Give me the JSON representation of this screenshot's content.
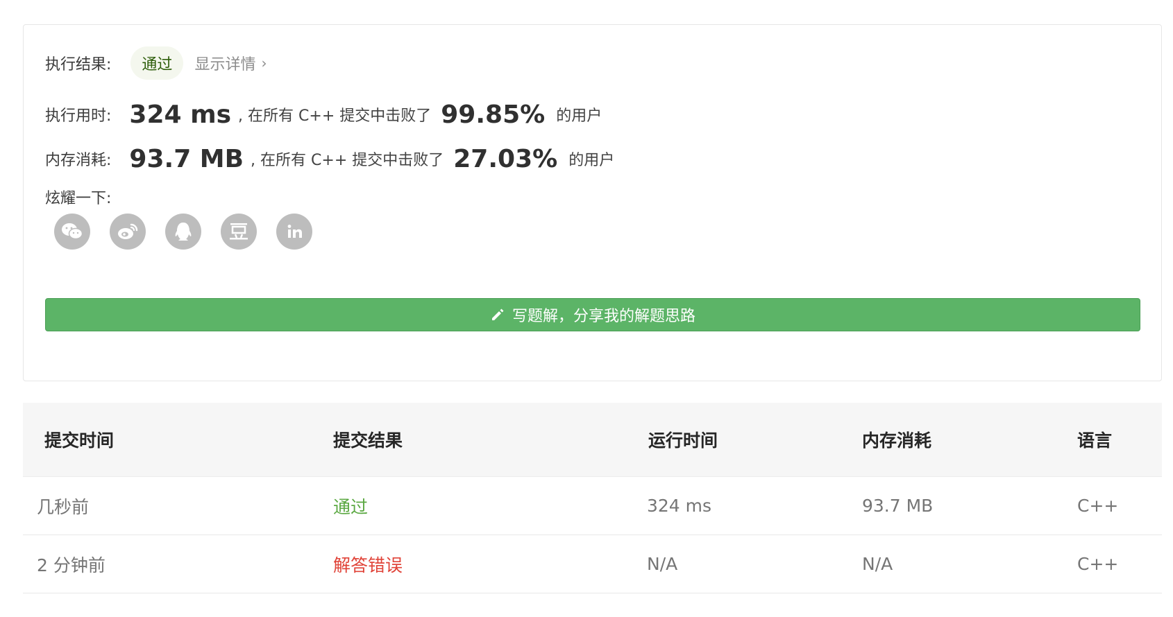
{
  "result": {
    "label": "执行结果:",
    "status": "通过",
    "detail_link": "显示详情",
    "chevron": "›"
  },
  "runtime": {
    "label": "执行用时:",
    "value": "324 ms",
    "mid_text": ", 在所有 C++ 提交中击败了",
    "percent": "99.85%",
    "tail_text": "的用户"
  },
  "memory": {
    "label": "内存消耗:",
    "value": "93.7 MB",
    "mid_text": ", 在所有 C++ 提交中击败了",
    "percent": "27.03%",
    "tail_text": "的用户"
  },
  "share": {
    "label": "炫耀一下:",
    "icons": [
      "wechat-icon",
      "weibo-icon",
      "qq-icon",
      "douban-icon",
      "linkedin-icon"
    ]
  },
  "write_button": {
    "label": "写题解，分享我的解题思路",
    "icon": "pencil-icon"
  },
  "table": {
    "headers": [
      "提交时间",
      "提交结果",
      "运行时间",
      "内存消耗",
      "语言"
    ],
    "rows": [
      {
        "time": "几秒前",
        "result": "通过",
        "runtime": "324 ms",
        "memory": "93.7 MB",
        "lang": "C++"
      },
      {
        "time": "2 分钟前",
        "result": "解答错误",
        "runtime": "N/A",
        "memory": "N/A",
        "lang": "C++"
      }
    ]
  },
  "colors": {
    "pass": "#5ba842",
    "fail": "#e04338",
    "button": "#5cb467",
    "share_icon_bg": "#bdbdbd"
  }
}
